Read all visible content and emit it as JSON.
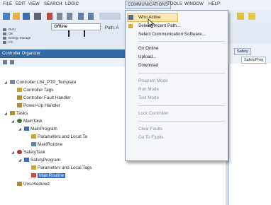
{
  "menubar": {
    "items": [
      "FILE",
      "EDIT",
      "VIEW",
      "SEARCH",
      "LOGIC",
      "COMMUNICATIONS",
      "TOOLS",
      "WINDOW",
      "HELP"
    ]
  },
  "toolbar": {
    "status_lines": [
      "RUN",
      "OK",
      "Energy Storage",
      "I/O"
    ],
    "mode_value": "Offline",
    "path_label": "Path: A"
  },
  "organizer": {
    "title": "Controller Organizer",
    "tree": [
      "Controller L84_PTP_Template",
      "Controller Tags",
      "Controller Fault Handler",
      "Power-Up Handler",
      "Tasks",
      "MainTask",
      "MainProgram",
      "Parameters and Local Ta",
      "MainRoutine",
      "SafetyTask",
      "SafetyProgram",
      "Parameters and Local Tags",
      "MainRoutine",
      "Unscheduled"
    ]
  },
  "right_tabs": [
    "Safety",
    "SafetyProg"
  ],
  "comm_menu": {
    "items": [
      {
        "label": "Who Active",
        "enabled": true
      },
      {
        "label": "Select Recent Path...",
        "enabled": true
      },
      {
        "label": "Select Communication Software...",
        "enabled": true
      },
      {
        "label": "Go Online",
        "enabled": true
      },
      {
        "label": "Upload...",
        "enabled": true
      },
      {
        "label": "Download",
        "enabled": true
      },
      {
        "label": "Program Mode",
        "enabled": false
      },
      {
        "label": "Run Mode",
        "enabled": false
      },
      {
        "label": "Test Mode",
        "enabled": false
      },
      {
        "label": "Lock Controller",
        "enabled": false
      },
      {
        "label": "Clear Faults",
        "enabled": false
      },
      {
        "label": "Go To Faults",
        "enabled": false
      }
    ]
  },
  "colors": {
    "accent": "#2f6aa6",
    "selection": "#2f6fcf",
    "highlight": "#fde9b0"
  }
}
